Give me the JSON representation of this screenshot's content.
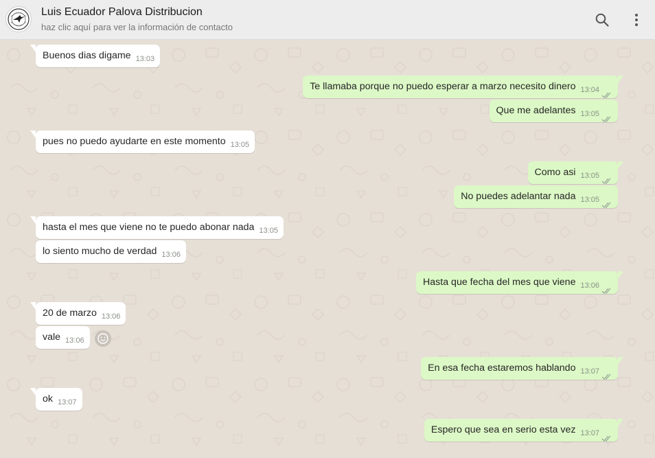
{
  "contact": {
    "name": "Luis Ecuador Palova Distribucion",
    "subtitle": "haz clic aquí para ver la información de contacto"
  },
  "icons": {
    "search": "search-icon",
    "menu": "more-vertical-icon",
    "ticks": "double-check-icon",
    "emoji": "smiley-icon"
  },
  "colors": {
    "header_bg": "#ededed",
    "chat_bg": "#e6dfd6",
    "incoming_bubble": "#ffffff",
    "outgoing_bubble": "#dcf8c6",
    "timestamp": "#8a9088"
  },
  "messages": [
    {
      "dir": "in",
      "text": "Buenos dias digame",
      "time": "13:03"
    },
    {
      "dir": "out",
      "text": "Te llamaba porque no puedo esperar a marzo necesito dinero",
      "time": "13:04"
    },
    {
      "dir": "out",
      "text": "Que me adelantes",
      "time": "13:05"
    },
    {
      "dir": "in",
      "text": "pues no puedo ayudarte en este momento",
      "time": "13:05"
    },
    {
      "dir": "out",
      "text": "Como asi",
      "time": "13:05"
    },
    {
      "dir": "out",
      "text": "No puedes adelantar nada",
      "time": "13:05"
    },
    {
      "dir": "in",
      "text": "hasta el mes que viene no te puedo abonar nada",
      "time": "13:05"
    },
    {
      "dir": "in",
      "text": "lo siento mucho de verdad",
      "time": "13:06"
    },
    {
      "dir": "out",
      "text": "Hasta que fecha del mes que viene",
      "time": "13:06"
    },
    {
      "dir": "in",
      "text": "20 de marzo",
      "time": "13:06"
    },
    {
      "dir": "in",
      "text": "vale",
      "time": "13:06"
    },
    {
      "dir": "out",
      "text": "En esa fecha estaremos hablando",
      "time": "13:07"
    },
    {
      "dir": "in",
      "text": "ok",
      "time": "13:07"
    },
    {
      "dir": "out",
      "text": "Espero que sea en serio esta vez",
      "time": "13:07"
    }
  ]
}
